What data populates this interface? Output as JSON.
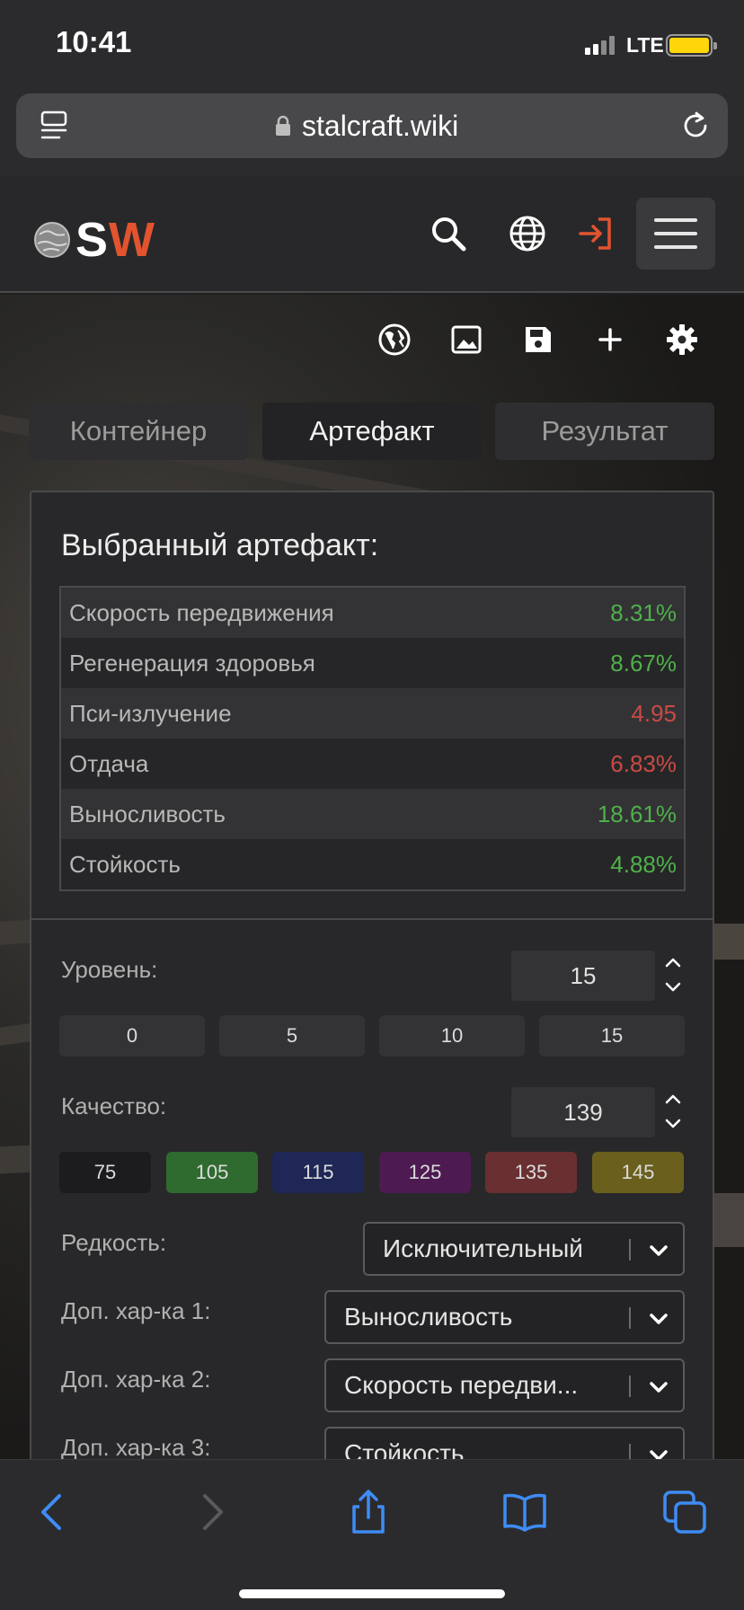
{
  "status": {
    "time": "10:41",
    "network": "LTE"
  },
  "browser": {
    "url": "stalcraft.wiki"
  },
  "site": {
    "logo_s": "S",
    "logo_w": "W"
  },
  "tabs": [
    {
      "label": "Контейнер",
      "active": false
    },
    {
      "label": "Артефакт",
      "active": true
    },
    {
      "label": "Результат",
      "active": false
    }
  ],
  "panel": {
    "title": "Выбранный артефакт:",
    "stats": [
      {
        "label": "Скорость передвижения",
        "value": "8.31%",
        "tone": "green"
      },
      {
        "label": "Регенерация здоровья",
        "value": "8.67%",
        "tone": "green"
      },
      {
        "label": "Пси-излучение",
        "value": "4.95",
        "tone": "red"
      },
      {
        "label": "Отдача",
        "value": "6.83%",
        "tone": "red"
      },
      {
        "label": "Выносливость",
        "value": "18.61%",
        "tone": "green"
      },
      {
        "label": "Стойкость",
        "value": "4.88%",
        "tone": "green"
      }
    ]
  },
  "form": {
    "level_label": "Уровень:",
    "level_value": "15",
    "level_presets": [
      "0",
      "5",
      "10",
      "15"
    ],
    "quality_label": "Качество:",
    "quality_value": "139",
    "quality_presets": [
      {
        "label": "75",
        "color": "#1c1c1e"
      },
      {
        "label": "105",
        "color": "#2f6a2f"
      },
      {
        "label": "115",
        "color": "#1e2756"
      },
      {
        "label": "125",
        "color": "#4d1a52"
      },
      {
        "label": "135",
        "color": "#6a2f30"
      },
      {
        "label": "145",
        "color": "#6a5f1c"
      }
    ],
    "rarity_label": "Редкость:",
    "rarity_value": "Исключительный",
    "extra1_label": "Доп. хар-ка 1:",
    "extra1_value": "Выносливость",
    "extra2_label": "Доп. хар-ка 2:",
    "extra2_value": "Скорость передви...",
    "extra3_label": "Доп. хар-ка 3:",
    "extra3_value": "Стойкость"
  },
  "colors": {
    "accent": "#e2542f",
    "ios_blue": "#3e8cf5",
    "green": "#4fb04a",
    "red": "#c94a44"
  }
}
